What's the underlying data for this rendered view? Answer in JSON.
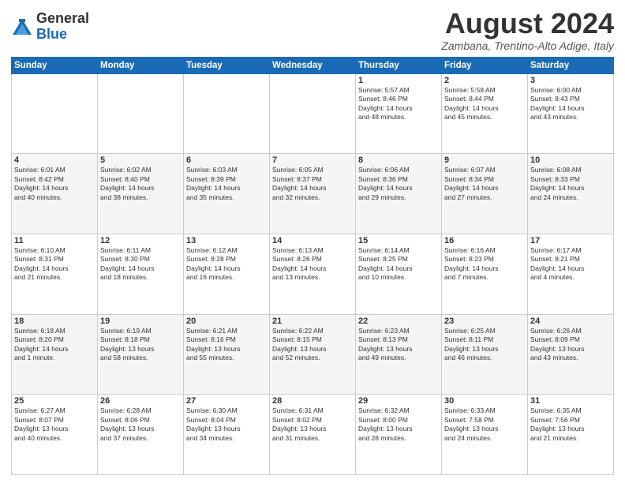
{
  "logo": {
    "general": "General",
    "blue": "Blue"
  },
  "title": "August 2024",
  "location": "Zambana, Trentino-Alto Adige, Italy",
  "days_of_week": [
    "Sunday",
    "Monday",
    "Tuesday",
    "Wednesday",
    "Thursday",
    "Friday",
    "Saturday"
  ],
  "weeks": [
    [
      {
        "num": "",
        "info": ""
      },
      {
        "num": "",
        "info": ""
      },
      {
        "num": "",
        "info": ""
      },
      {
        "num": "",
        "info": ""
      },
      {
        "num": "1",
        "info": "Sunrise: 5:57 AM\nSunset: 8:46 PM\nDaylight: 14 hours\nand 48 minutes."
      },
      {
        "num": "2",
        "info": "Sunrise: 5:58 AM\nSunset: 8:44 PM\nDaylight: 14 hours\nand 45 minutes."
      },
      {
        "num": "3",
        "info": "Sunrise: 6:00 AM\nSunset: 8:43 PM\nDaylight: 14 hours\nand 43 minutes."
      }
    ],
    [
      {
        "num": "4",
        "info": "Sunrise: 6:01 AM\nSunset: 8:42 PM\nDaylight: 14 hours\nand 40 minutes."
      },
      {
        "num": "5",
        "info": "Sunrise: 6:02 AM\nSunset: 8:40 PM\nDaylight: 14 hours\nand 38 minutes."
      },
      {
        "num": "6",
        "info": "Sunrise: 6:03 AM\nSunset: 8:39 PM\nDaylight: 14 hours\nand 35 minutes."
      },
      {
        "num": "7",
        "info": "Sunrise: 6:05 AM\nSunset: 8:37 PM\nDaylight: 14 hours\nand 32 minutes."
      },
      {
        "num": "8",
        "info": "Sunrise: 6:06 AM\nSunset: 8:36 PM\nDaylight: 14 hours\nand 29 minutes."
      },
      {
        "num": "9",
        "info": "Sunrise: 6:07 AM\nSunset: 8:34 PM\nDaylight: 14 hours\nand 27 minutes."
      },
      {
        "num": "10",
        "info": "Sunrise: 6:08 AM\nSunset: 8:33 PM\nDaylight: 14 hours\nand 24 minutes."
      }
    ],
    [
      {
        "num": "11",
        "info": "Sunrise: 6:10 AM\nSunset: 8:31 PM\nDaylight: 14 hours\nand 21 minutes."
      },
      {
        "num": "12",
        "info": "Sunrise: 6:11 AM\nSunset: 8:30 PM\nDaylight: 14 hours\nand 18 minutes."
      },
      {
        "num": "13",
        "info": "Sunrise: 6:12 AM\nSunset: 8:28 PM\nDaylight: 14 hours\nand 16 minutes."
      },
      {
        "num": "14",
        "info": "Sunrise: 6:13 AM\nSunset: 8:26 PM\nDaylight: 14 hours\nand 13 minutes."
      },
      {
        "num": "15",
        "info": "Sunrise: 6:14 AM\nSunset: 8:25 PM\nDaylight: 14 hours\nand 10 minutes."
      },
      {
        "num": "16",
        "info": "Sunrise: 6:16 AM\nSunset: 8:23 PM\nDaylight: 14 hours\nand 7 minutes."
      },
      {
        "num": "17",
        "info": "Sunrise: 6:17 AM\nSunset: 8:21 PM\nDaylight: 14 hours\nand 4 minutes."
      }
    ],
    [
      {
        "num": "18",
        "info": "Sunrise: 6:18 AM\nSunset: 8:20 PM\nDaylight: 14 hours\nand 1 minute."
      },
      {
        "num": "19",
        "info": "Sunrise: 6:19 AM\nSunset: 8:18 PM\nDaylight: 13 hours\nand 58 minutes."
      },
      {
        "num": "20",
        "info": "Sunrise: 6:21 AM\nSunset: 8:16 PM\nDaylight: 13 hours\nand 55 minutes."
      },
      {
        "num": "21",
        "info": "Sunrise: 6:22 AM\nSunset: 8:15 PM\nDaylight: 13 hours\nand 52 minutes."
      },
      {
        "num": "22",
        "info": "Sunrise: 6:23 AM\nSunset: 8:13 PM\nDaylight: 13 hours\nand 49 minutes."
      },
      {
        "num": "23",
        "info": "Sunrise: 6:25 AM\nSunset: 8:11 PM\nDaylight: 13 hours\nand 46 minutes."
      },
      {
        "num": "24",
        "info": "Sunrise: 6:26 AM\nSunset: 8:09 PM\nDaylight: 13 hours\nand 43 minutes."
      }
    ],
    [
      {
        "num": "25",
        "info": "Sunrise: 6:27 AM\nSunset: 8:07 PM\nDaylight: 13 hours\nand 40 minutes."
      },
      {
        "num": "26",
        "info": "Sunrise: 6:28 AM\nSunset: 8:06 PM\nDaylight: 13 hours\nand 37 minutes."
      },
      {
        "num": "27",
        "info": "Sunrise: 6:30 AM\nSunset: 8:04 PM\nDaylight: 13 hours\nand 34 minutes."
      },
      {
        "num": "28",
        "info": "Sunrise: 6:31 AM\nSunset: 8:02 PM\nDaylight: 13 hours\nand 31 minutes."
      },
      {
        "num": "29",
        "info": "Sunrise: 6:32 AM\nSunset: 8:00 PM\nDaylight: 13 hours\nand 28 minutes."
      },
      {
        "num": "30",
        "info": "Sunrise: 6:33 AM\nSunset: 7:58 PM\nDaylight: 13 hours\nand 24 minutes."
      },
      {
        "num": "31",
        "info": "Sunrise: 6:35 AM\nSunset: 7:56 PM\nDaylight: 13 hours\nand 21 minutes."
      }
    ]
  ]
}
